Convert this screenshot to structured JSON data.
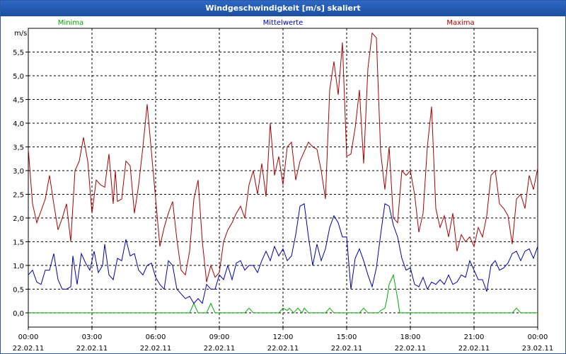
{
  "window": {
    "title": "Windgeschwindigkeit [m/s] skaliert"
  },
  "chart_data": {
    "type": "line",
    "title": "Windgeschwindigkeit [m/s] skaliert",
    "ylabel": "m/s",
    "ylim": [
      -0.3,
      6.0
    ],
    "xlim": [
      0,
      24
    ],
    "grid": true,
    "legend_position": "top",
    "y_ticks": [
      "0,0",
      "0,5",
      "1,0",
      "1,5",
      "2,0",
      "2,5",
      "3,0",
      "3,5",
      "4,0",
      "4,5",
      "5,0",
      "5,5"
    ],
    "y_tick_values": [
      0,
      0.5,
      1.0,
      1.5,
      2.0,
      2.5,
      3.0,
      3.5,
      4.0,
      4.5,
      5.0,
      5.5
    ],
    "x_ticks": [
      {
        "time": "00:00",
        "date": "22.02.11"
      },
      {
        "time": "03:00",
        "date": "22.02.11"
      },
      {
        "time": "06:00",
        "date": "22.02.11"
      },
      {
        "time": "09:00",
        "date": "22.02.11"
      },
      {
        "time": "12:00",
        "date": "22.02.11"
      },
      {
        "time": "15:00",
        "date": "22.02.11"
      },
      {
        "time": "18:00",
        "date": "22.02.11"
      },
      {
        "time": "21:00",
        "date": "22.02.11"
      },
      {
        "time": "00:00",
        "date": "23.02.11"
      }
    ],
    "series": [
      {
        "name": "Minima",
        "color": "#00aa00",
        "points": [
          [
            0,
            0
          ],
          [
            7.6,
            0
          ],
          [
            7.8,
            0.2
          ],
          [
            8.0,
            0
          ],
          [
            8.4,
            0
          ],
          [
            8.6,
            0.2
          ],
          [
            8.8,
            0
          ],
          [
            10.2,
            0
          ],
          [
            10.4,
            0.1
          ],
          [
            10.6,
            0
          ],
          [
            11.8,
            0
          ],
          [
            12.0,
            0.1
          ],
          [
            12.2,
            0.05
          ],
          [
            12.3,
            0.1
          ],
          [
            12.5,
            0
          ],
          [
            12.7,
            0.1
          ],
          [
            12.9,
            0
          ],
          [
            13.0,
            0.1
          ],
          [
            13.2,
            0
          ],
          [
            14.0,
            0
          ],
          [
            14.2,
            0.1
          ],
          [
            14.4,
            0
          ],
          [
            15.6,
            0
          ],
          [
            15.8,
            0.1
          ],
          [
            16.0,
            0
          ],
          [
            16.5,
            0
          ],
          [
            16.6,
            0.05
          ],
          [
            16.8,
            0.1
          ],
          [
            16.9,
            0.3
          ],
          [
            17.0,
            0.6
          ],
          [
            17.1,
            0.7
          ],
          [
            17.2,
            0.8
          ],
          [
            17.4,
            0.3
          ],
          [
            17.5,
            0
          ],
          [
            22.8,
            0
          ],
          [
            23.0,
            0.1
          ],
          [
            23.2,
            0
          ],
          [
            24.0,
            0
          ]
        ]
      },
      {
        "name": "Mittelwerte",
        "color": "#0000aa",
        "points": [
          [
            0,
            0.8
          ],
          [
            0.2,
            0.9
          ],
          [
            0.4,
            0.65
          ],
          [
            0.6,
            0.6
          ],
          [
            0.8,
            0.9
          ],
          [
            1.0,
            0.9
          ],
          [
            1.2,
            1.25
          ],
          [
            1.4,
            0.7
          ],
          [
            1.6,
            0.5
          ],
          [
            1.8,
            0.5
          ],
          [
            2.0,
            0.55
          ],
          [
            2.1,
            1.2
          ],
          [
            2.3,
            0.6
          ],
          [
            2.5,
            1.25
          ],
          [
            2.7,
            1.05
          ],
          [
            2.9,
            0.9
          ],
          [
            3.1,
            1.3
          ],
          [
            3.3,
            0.85
          ],
          [
            3.5,
            1.0
          ],
          [
            3.6,
            1.45
          ],
          [
            3.8,
            0.8
          ],
          [
            4.0,
            0.7
          ],
          [
            4.2,
            1.15
          ],
          [
            4.4,
            1.1
          ],
          [
            4.6,
            1.55
          ],
          [
            4.8,
            1.2
          ],
          [
            5.0,
            1.25
          ],
          [
            5.2,
            0.9
          ],
          [
            5.4,
            0.8
          ],
          [
            5.6,
            1.0
          ],
          [
            5.8,
            1.05
          ],
          [
            6.0,
            0.75
          ],
          [
            6.2,
            0.6
          ],
          [
            6.4,
            0.5
          ],
          [
            6.6,
            1.1
          ],
          [
            6.8,
            1.0
          ],
          [
            7.0,
            0.5
          ],
          [
            7.2,
            0.4
          ],
          [
            7.4,
            0.3
          ],
          [
            7.6,
            0.35
          ],
          [
            7.8,
            0.2
          ],
          [
            8.0,
            0.3
          ],
          [
            8.2,
            0.2
          ],
          [
            8.4,
            0.6
          ],
          [
            8.6,
            0.5
          ],
          [
            8.8,
            0.5
          ],
          [
            9.0,
            0.8
          ],
          [
            9.2,
            0.7
          ],
          [
            9.4,
            1.0
          ],
          [
            9.6,
            0.7
          ],
          [
            9.8,
            1.05
          ],
          [
            10.0,
            1.1
          ],
          [
            10.2,
            0.9
          ],
          [
            10.4,
            1.0
          ],
          [
            10.6,
            1.0
          ],
          [
            10.8,
            0.85
          ],
          [
            11.0,
            1.1
          ],
          [
            11.2,
            1.3
          ],
          [
            11.4,
            1.1
          ],
          [
            11.6,
            1.4
          ],
          [
            11.8,
            1.2
          ],
          [
            12.0,
            1.35
          ],
          [
            12.2,
            1.1
          ],
          [
            12.4,
            1.2
          ],
          [
            12.6,
            1.65
          ],
          [
            12.8,
            2.25
          ],
          [
            13.0,
            2.3
          ],
          [
            13.2,
            1.6
          ],
          [
            13.4,
            1.0
          ],
          [
            13.6,
            1.45
          ],
          [
            13.8,
            1.1
          ],
          [
            14.0,
            1.35
          ],
          [
            14.2,
            1.8
          ],
          [
            14.4,
            2.05
          ],
          [
            14.6,
            1.9
          ],
          [
            14.8,
            1.6
          ],
          [
            15.0,
            1.6
          ],
          [
            15.2,
            0.5
          ],
          [
            15.4,
            1.15
          ],
          [
            15.6,
            1.35
          ],
          [
            15.8,
            1.1
          ],
          [
            16.0,
            0.8
          ],
          [
            16.2,
            0.55
          ],
          [
            16.4,
            0.95
          ],
          [
            16.6,
            1.65
          ],
          [
            16.8,
            2.3
          ],
          [
            17.0,
            2.25
          ],
          [
            17.2,
            1.85
          ],
          [
            17.4,
            1.6
          ],
          [
            17.6,
            1.15
          ],
          [
            17.8,
            0.9
          ],
          [
            18.0,
            0.95
          ],
          [
            18.2,
            0.6
          ],
          [
            18.4,
            0.55
          ],
          [
            18.6,
            0.75
          ],
          [
            18.8,
            0.5
          ],
          [
            19.0,
            0.65
          ],
          [
            19.2,
            0.6
          ],
          [
            19.4,
            0.7
          ],
          [
            19.6,
            0.6
          ],
          [
            19.8,
            0.8
          ],
          [
            20.0,
            0.6
          ],
          [
            20.2,
            0.65
          ],
          [
            20.4,
            0.8
          ],
          [
            20.6,
            0.75
          ],
          [
            20.8,
            1.1
          ],
          [
            21.0,
            0.9
          ],
          [
            21.2,
            0.7
          ],
          [
            21.4,
            0.7
          ],
          [
            21.6,
            0.45
          ],
          [
            21.8,
            1.0
          ],
          [
            22.0,
            1.1
          ],
          [
            22.2,
            0.9
          ],
          [
            22.4,
            0.95
          ],
          [
            22.6,
            1.05
          ],
          [
            22.8,
            1.25
          ],
          [
            23.0,
            1.3
          ],
          [
            23.2,
            1.1
          ],
          [
            23.4,
            1.3
          ],
          [
            23.6,
            1.35
          ],
          [
            23.8,
            1.15
          ],
          [
            24.0,
            1.4
          ]
        ]
      },
      {
        "name": "Maxima",
        "color": "#aa0000",
        "points": [
          [
            0,
            3.45
          ],
          [
            0.2,
            2.3
          ],
          [
            0.4,
            1.9
          ],
          [
            0.6,
            2.15
          ],
          [
            0.8,
            2.4
          ],
          [
            1.0,
            2.9
          ],
          [
            1.2,
            2.3
          ],
          [
            1.4,
            1.75
          ],
          [
            1.6,
            2.0
          ],
          [
            1.8,
            2.3
          ],
          [
            2.0,
            1.5
          ],
          [
            2.2,
            3.0
          ],
          [
            2.4,
            3.2
          ],
          [
            2.6,
            3.7
          ],
          [
            2.8,
            3.2
          ],
          [
            3.0,
            2.1
          ],
          [
            3.2,
            2.8
          ],
          [
            3.4,
            2.7
          ],
          [
            3.6,
            2.65
          ],
          [
            3.8,
            3.35
          ],
          [
            4.0,
            2.3
          ],
          [
            4.1,
            3.0
          ],
          [
            4.2,
            2.35
          ],
          [
            4.4,
            2.4
          ],
          [
            4.6,
            3.2
          ],
          [
            4.8,
            3.1
          ],
          [
            5.0,
            2.1
          ],
          [
            5.2,
            2.7
          ],
          [
            5.4,
            3.5
          ],
          [
            5.6,
            4.4
          ],
          [
            5.8,
            3.4
          ],
          [
            6.0,
            2.4
          ],
          [
            6.2,
            1.4
          ],
          [
            6.4,
            1.8
          ],
          [
            6.6,
            2.1
          ],
          [
            6.8,
            2.35
          ],
          [
            7.0,
            1.55
          ],
          [
            7.2,
            0.9
          ],
          [
            7.4,
            0.8
          ],
          [
            7.6,
            1.3
          ],
          [
            7.8,
            2.4
          ],
          [
            8.0,
            2.8
          ],
          [
            8.2,
            1.5
          ],
          [
            8.4,
            0.65
          ],
          [
            8.6,
            1.0
          ],
          [
            8.8,
            0.75
          ],
          [
            9.0,
            0.85
          ],
          [
            9.2,
            1.5
          ],
          [
            9.4,
            1.75
          ],
          [
            9.6,
            1.9
          ],
          [
            9.8,
            2.1
          ],
          [
            10.0,
            2.25
          ],
          [
            10.2,
            2.0
          ],
          [
            10.4,
            2.7
          ],
          [
            10.6,
            3.0
          ],
          [
            10.8,
            2.5
          ],
          [
            11.0,
            3.15
          ],
          [
            11.2,
            2.45
          ],
          [
            11.4,
            4.0
          ],
          [
            11.6,
            2.9
          ],
          [
            11.8,
            3.3
          ],
          [
            12.0,
            2.7
          ],
          [
            12.2,
            3.5
          ],
          [
            12.4,
            3.6
          ],
          [
            12.6,
            2.8
          ],
          [
            12.8,
            3.2
          ],
          [
            13.0,
            3.4
          ],
          [
            13.2,
            3.6
          ],
          [
            13.4,
            3.5
          ],
          [
            13.6,
            3.45
          ],
          [
            13.8,
            3.0
          ],
          [
            14.0,
            2.4
          ],
          [
            14.2,
            4.7
          ],
          [
            14.4,
            5.3
          ],
          [
            14.6,
            4.6
          ],
          [
            14.8,
            5.7
          ],
          [
            15.0,
            3.3
          ],
          [
            15.2,
            3.35
          ],
          [
            15.4,
            3.9
          ],
          [
            15.6,
            4.7
          ],
          [
            15.8,
            3.15
          ],
          [
            16.0,
            5.15
          ],
          [
            16.2,
            5.9
          ],
          [
            16.4,
            5.8
          ],
          [
            16.6,
            3.4
          ],
          [
            16.8,
            2.6
          ],
          [
            17.0,
            3.5
          ],
          [
            17.2,
            2.0
          ],
          [
            17.4,
            1.9
          ],
          [
            17.6,
            3.0
          ],
          [
            17.8,
            2.9
          ],
          [
            18.0,
            3.0
          ],
          [
            18.2,
            2.5
          ],
          [
            18.4,
            1.7
          ],
          [
            18.6,
            2.1
          ],
          [
            18.8,
            3.5
          ],
          [
            19.0,
            4.35
          ],
          [
            19.2,
            2.2
          ],
          [
            19.4,
            1.8
          ],
          [
            19.6,
            2.05
          ],
          [
            19.8,
            1.6
          ],
          [
            20.0,
            2.1
          ],
          [
            20.2,
            1.3
          ],
          [
            20.4,
            1.65
          ],
          [
            20.6,
            1.5
          ],
          [
            20.8,
            1.6
          ],
          [
            21.0,
            1.4
          ],
          [
            21.2,
            1.8
          ],
          [
            21.4,
            1.6
          ],
          [
            21.6,
            2.05
          ],
          [
            21.8,
            2.9
          ],
          [
            22.0,
            3.0
          ],
          [
            22.2,
            2.3
          ],
          [
            22.4,
            2.2
          ],
          [
            22.6,
            2.05
          ],
          [
            22.8,
            1.45
          ],
          [
            23.0,
            2.4
          ],
          [
            23.2,
            2.5
          ],
          [
            23.4,
            2.2
          ],
          [
            23.6,
            2.9
          ],
          [
            23.8,
            2.6
          ],
          [
            24.0,
            3.05
          ]
        ]
      }
    ]
  }
}
